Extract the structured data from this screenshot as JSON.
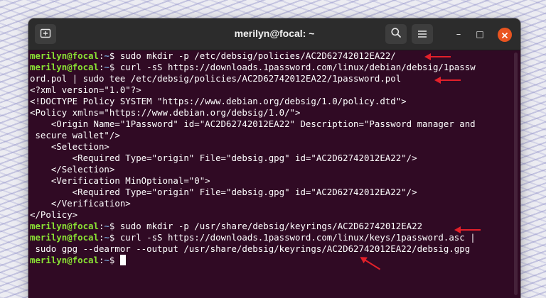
{
  "window": {
    "title": "merilyn@focal: ~",
    "accent_color": "#e95420",
    "background_color": "#300a24"
  },
  "titlebar": {
    "new_tab_icon": "new-tab-icon",
    "search_icon": "search-icon",
    "menu_icon": "hamburger-menu-icon",
    "minimize_glyph": "–",
    "maximize_glyph": "□",
    "close_glyph": "✕"
  },
  "prompt": {
    "user": "merilyn@focal",
    "sep": ":",
    "path": "~",
    "symbol": "$ "
  },
  "terminal": {
    "lines": [
      {
        "type": "cmd",
        "text": "sudo mkdir -p /etc/debsig/policies/AC2D62742012EA22/"
      },
      {
        "type": "cmd",
        "text": "curl -sS https://downloads.1password.com/linux/debian/debsig/1passw"
      },
      {
        "type": "out",
        "text": "ord.pol | sudo tee /etc/debsig/policies/AC2D62742012EA22/1password.pol"
      },
      {
        "type": "out",
        "text": "<?xml version=\"1.0\"?>"
      },
      {
        "type": "out",
        "text": "<!DOCTYPE Policy SYSTEM \"https://www.debian.org/debsig/1.0/policy.dtd\">"
      },
      {
        "type": "out",
        "text": "<Policy xmlns=\"https://www.debian.org/debsig/1.0/\">"
      },
      {
        "type": "out",
        "text": "    <Origin Name=\"1Password\" id=\"AC2D62742012EA22\" Description=\"Password manager and"
      },
      {
        "type": "out",
        "text": " secure wallet\"/>"
      },
      {
        "type": "out",
        "text": "    <Selection>"
      },
      {
        "type": "out",
        "text": "        <Required Type=\"origin\" File=\"debsig.gpg\" id=\"AC2D62742012EA22\"/>"
      },
      {
        "type": "out",
        "text": "    </Selection>"
      },
      {
        "type": "out",
        "text": "    <Verification MinOptional=\"0\">"
      },
      {
        "type": "out",
        "text": "        <Required Type=\"origin\" File=\"debsig.gpg\" id=\"AC2D62742012EA22\"/>"
      },
      {
        "type": "out",
        "text": "    </Verification>"
      },
      {
        "type": "out",
        "text": "</Policy>"
      },
      {
        "type": "cmd",
        "text": "sudo mkdir -p /usr/share/debsig/keyrings/AC2D62742012EA22"
      },
      {
        "type": "cmd",
        "text": "curl -sS https://downloads.1password.com/linux/keys/1password.asc |"
      },
      {
        "type": "out",
        "text": " sudo gpg --dearmor --output /usr/share/debsig/keyrings/AC2D62742012EA22/debsig.gpg"
      },
      {
        "type": "cursor",
        "text": ""
      }
    ]
  },
  "annotations": {
    "arrow_color": "#e2202a"
  }
}
